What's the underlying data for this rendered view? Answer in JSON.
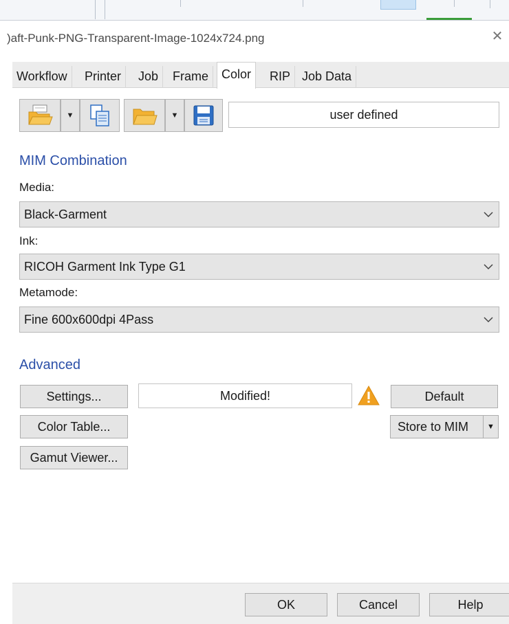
{
  "window": {
    "title": ")aft-Punk-PNG-Transparent-Image-1024x724.png",
    "close_glyph": "✕"
  },
  "tabs": [
    {
      "label": "Workflow"
    },
    {
      "label": "Printer"
    },
    {
      "label": "Job"
    },
    {
      "label": "Frame"
    },
    {
      "label": "Color",
      "active": true
    },
    {
      "label": "RIP"
    },
    {
      "label": "Job Data"
    }
  ],
  "toolbar": {
    "icons": [
      "open-folder-icon",
      "copy-documents-icon",
      "open-folder-icon",
      "save-disk-icon"
    ],
    "preset_value": "user defined"
  },
  "mim": {
    "title": "MIM Combination",
    "media_label": "Media:",
    "media_value": "Black-Garment",
    "ink_label": "Ink:",
    "ink_value": "RICOH Garment Ink Type G1",
    "metamode_label": "Metamode:",
    "metamode_value": "Fine 600x600dpi 4Pass"
  },
  "advanced": {
    "title": "Advanced",
    "settings_label": "Settings...",
    "status_value": "Modified!",
    "default_label": "Default",
    "color_table_label": "Color Table...",
    "store_label": "Store to MIM",
    "gamut_label": "Gamut Viewer..."
  },
  "footer": {
    "ok_label": "OK",
    "cancel_label": "Cancel",
    "help_label": "Help"
  },
  "colors": {
    "section_title": "#2b4fa8",
    "warning": "#f0a020",
    "folder": "#f2b233",
    "save_disk": "#2f6fc4"
  }
}
